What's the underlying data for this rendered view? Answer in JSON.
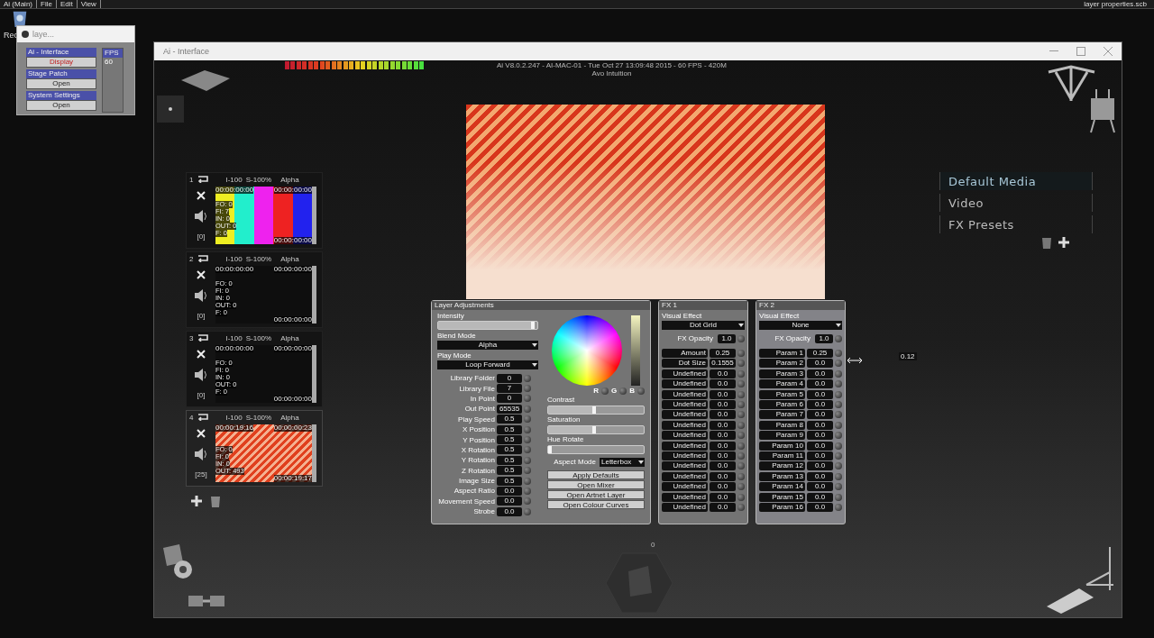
{
  "os_menu": [
    "Ai (Main)",
    "File",
    "Edit",
    "View"
  ],
  "os_title": "layer properties.scb",
  "desktop_icon": {
    "label": "Rec"
  },
  "mini_window": {
    "title": "laye...",
    "groups": [
      {
        "label": "Ai - Interface",
        "button": "Display",
        "highlighted": true
      },
      {
        "label": "Stage Patch",
        "button": "Open",
        "highlighted": false
      },
      {
        "label": "System Settings",
        "button": "Open",
        "highlighted": false
      }
    ],
    "fps_label": "FPS",
    "fps_value": "60"
  },
  "window": {
    "title": "Ai - Interface"
  },
  "info": {
    "line1": "Ai V8.0.2.247 - AI-MAC-01 - Tue Oct 27 13:09:48 2015 - 60 FPS - 420M",
    "line2": "Avo Intuition"
  },
  "layers": [
    {
      "number": "1",
      "intensity": "I-100",
      "speed": "S-100%",
      "blend": "Alpha",
      "counter": "[0]",
      "selected": false,
      "kind": "pattern",
      "time_start": "00:00:00:00",
      "time_end": "00:00:00:00",
      "time_pos": "00:00:00:00",
      "stats": [
        "FO: 0",
        "FI: 7",
        "IN: 0",
        "OUT: 0",
        "F: 0"
      ]
    },
    {
      "number": "2",
      "intensity": "I-100",
      "speed": "S-100%",
      "blend": "Alpha",
      "counter": "[0]",
      "selected": false,
      "kind": "empty",
      "time_start": "00:00:00:00",
      "time_end": "00:00:00:00",
      "time_pos": "00:00:00:00",
      "stats": [
        "FO: 0",
        "FI: 0",
        "IN: 0",
        "OUT: 0",
        "F: 0"
      ]
    },
    {
      "number": "3",
      "intensity": "I-100",
      "speed": "S-100%",
      "blend": "Alpha",
      "counter": "[0]",
      "selected": false,
      "kind": "empty",
      "time_start": "00:00:00:00",
      "time_end": "00:00:00:00",
      "time_pos": "00:00:00:00",
      "stats": [
        "FO: 0",
        "FI: 0",
        "IN: 0",
        "OUT: 0",
        "F: 0"
      ]
    },
    {
      "number": "4",
      "intensity": "I-100",
      "speed": "S-100%",
      "blend": "Alpha",
      "counter": "[25]",
      "selected": true,
      "kind": "video",
      "time_start": "00:00:19:16",
      "time_end": "00:00:00:23",
      "time_pos": "00:00:19:17",
      "stats": [
        "FO: 0",
        "FI: 0",
        "IN: 0",
        "OUT: 493"
      ]
    }
  ],
  "adjustments": {
    "title": "Layer Adjustments",
    "intensity": {
      "label": "Intensity",
      "level": 0.97
    },
    "blend_mode": {
      "label": "Blend Mode",
      "value": "Alpha"
    },
    "play_mode": {
      "label": "Play Mode",
      "value": "Loop Forward"
    },
    "params": [
      {
        "label": "Library Folder",
        "value": "0"
      },
      {
        "label": "Library File",
        "value": "7"
      },
      {
        "label": "In Point",
        "value": "0"
      },
      {
        "label": "Out Point",
        "value": "65535"
      },
      {
        "label": "Play Speed",
        "value": "0.5"
      },
      {
        "label": "X Position",
        "value": "0.5"
      },
      {
        "label": "Y Position",
        "value": "0.5"
      },
      {
        "label": "X Rotation",
        "value": "0.5"
      },
      {
        "label": "Y Rotation",
        "value": "0.5"
      },
      {
        "label": "Z Rotation",
        "value": "0.5"
      },
      {
        "label": "Image Size",
        "value": "0.5"
      },
      {
        "label": "Aspect Ratio",
        "value": "0.0"
      },
      {
        "label": "Movement Speed",
        "value": "0.0"
      },
      {
        "label": "Strobe",
        "value": "0.0"
      }
    ],
    "brightness": {
      "level": 1
    },
    "rgb": [
      "R",
      "G",
      "B"
    ],
    "sliders": [
      {
        "label": "Contrast",
        "level": 0.5
      },
      {
        "label": "Saturation",
        "level": 0.5
      },
      {
        "label": "Hue Rotate",
        "level": 0.03
      }
    ],
    "aspect_mode": {
      "label": "Aspect Mode",
      "value": "Letterbox"
    },
    "buttons": [
      "Apply Defaults",
      "Open Mixer",
      "Open Artnet Layer",
      "Open Colour Curves"
    ]
  },
  "fx": [
    {
      "title": "FX 1",
      "effect_label": "Visual Effect",
      "effect": "Dot Grid",
      "opacity_label": "FX Opacity",
      "opacity": "1.0",
      "tooltip": "0.12",
      "params": [
        {
          "label": "Amount",
          "value": "0.25"
        },
        {
          "label": "Dot Size",
          "value": "0.1555"
        },
        {
          "label": "Undefined",
          "value": "0.0"
        },
        {
          "label": "Undefined",
          "value": "0.0"
        },
        {
          "label": "Undefined",
          "value": "0.0"
        },
        {
          "label": "Undefined",
          "value": "0.0"
        },
        {
          "label": "Undefined",
          "value": "0.0"
        },
        {
          "label": "Undefined",
          "value": "0.0"
        },
        {
          "label": "Undefined",
          "value": "0.0"
        },
        {
          "label": "Undefined",
          "value": "0.0"
        },
        {
          "label": "Undefined",
          "value": "0.0"
        },
        {
          "label": "Undefined",
          "value": "0.0"
        },
        {
          "label": "Undefined",
          "value": "0.0"
        },
        {
          "label": "Undefined",
          "value": "0.0"
        },
        {
          "label": "Undefined",
          "value": "0.0"
        },
        {
          "label": "Undefined",
          "value": "0.0"
        }
      ]
    },
    {
      "title": "FX 2",
      "effect_label": "Visual Effect",
      "effect": "None",
      "opacity_label": "FX Opacity",
      "opacity": "1.0",
      "params": [
        {
          "label": "Param 1",
          "value": "0.25"
        },
        {
          "label": "Param 2",
          "value": "0.0"
        },
        {
          "label": "Param 3",
          "value": "0.0"
        },
        {
          "label": "Param 4",
          "value": "0.0"
        },
        {
          "label": "Param 5",
          "value": "0.0"
        },
        {
          "label": "Param 6",
          "value": "0.0"
        },
        {
          "label": "Param 7",
          "value": "0.0"
        },
        {
          "label": "Param 8",
          "value": "0.0"
        },
        {
          "label": "Param 9",
          "value": "0.0"
        },
        {
          "label": "Param 10",
          "value": "0.0"
        },
        {
          "label": "Param 11",
          "value": "0.0"
        },
        {
          "label": "Param 12",
          "value": "0.0"
        },
        {
          "label": "Param 13",
          "value": "0.0"
        },
        {
          "label": "Param 14",
          "value": "0.0"
        },
        {
          "label": "Param 15",
          "value": "0.0"
        },
        {
          "label": "Param 16",
          "value": "0.0"
        }
      ]
    }
  ],
  "media_menu": [
    {
      "label": "Default Media",
      "selected": true
    },
    {
      "label": "Video",
      "selected": false
    },
    {
      "label": "FX Presets",
      "selected": false
    }
  ],
  "hub_label": "0"
}
